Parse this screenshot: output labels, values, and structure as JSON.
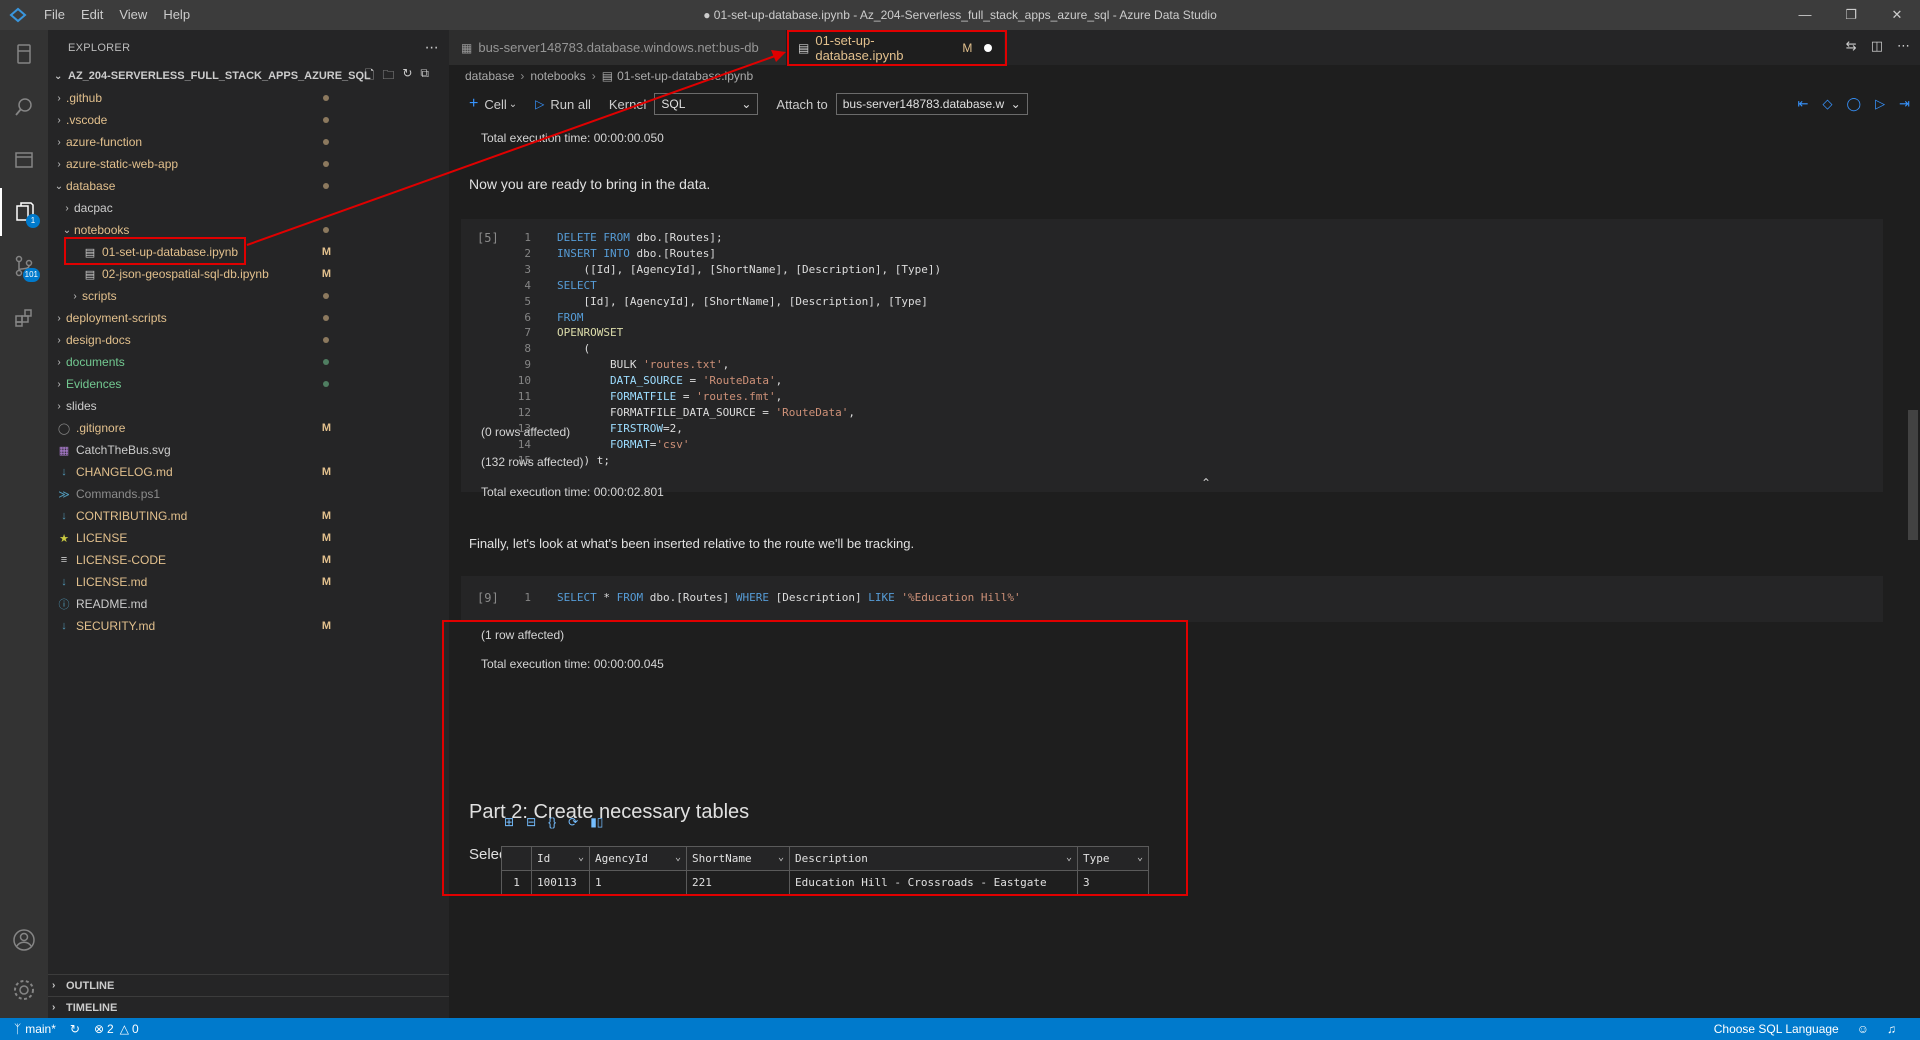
{
  "window": {
    "title": "● 01-set-up-database.ipynb - Az_204-Serverless_full_stack_apps_azure_sql - Azure Data Studio",
    "menu": [
      "File",
      "Edit",
      "View",
      "Help"
    ]
  },
  "activity": {
    "badge_explorer": "1",
    "badge_scm": "101"
  },
  "sidebar": {
    "header": "EXPLORER",
    "root": "AZ_204-SERVERLESS_FULL_STACK_APPS_AZURE_SQL",
    "items": [
      {
        "label": ".github",
        "badge": ""
      },
      {
        "label": ".vscode",
        "badge": ""
      },
      {
        "label": "azure-function",
        "badge": ""
      },
      {
        "label": "azure-static-web-app",
        "badge": ""
      },
      {
        "label": "database",
        "badge": ""
      },
      {
        "label": "dacpac",
        "badge": ""
      },
      {
        "label": "notebooks",
        "badge": ""
      },
      {
        "label": "01-set-up-database.ipynb",
        "badge": "M"
      },
      {
        "label": "02-json-geospatial-sql-db.ipynb",
        "badge": "M"
      },
      {
        "label": "scripts",
        "badge": ""
      },
      {
        "label": "deployment-scripts",
        "badge": ""
      },
      {
        "label": "design-docs",
        "badge": ""
      },
      {
        "label": "documents",
        "badge": ""
      },
      {
        "label": "Evidences",
        "badge": ""
      },
      {
        "label": "slides",
        "badge": ""
      },
      {
        "label": ".gitignore",
        "badge": "M"
      },
      {
        "label": "CatchTheBus.svg",
        "badge": ""
      },
      {
        "label": "CHANGELOG.md",
        "badge": "M"
      },
      {
        "label": "Commands.ps1",
        "badge": ""
      },
      {
        "label": "CONTRIBUTING.md",
        "badge": "M"
      },
      {
        "label": "LICENSE",
        "badge": "M"
      },
      {
        "label": "LICENSE-CODE",
        "badge": "M"
      },
      {
        "label": "LICENSE.md",
        "badge": "M"
      },
      {
        "label": "README.md",
        "badge": ""
      },
      {
        "label": "SECURITY.md",
        "badge": "M"
      }
    ],
    "outline": "OUTLINE",
    "timeline": "TIMELINE"
  },
  "tabs": [
    {
      "label": "bus-server148783.database.windows.net:bus-db"
    },
    {
      "label": "01-set-up-database.ipynb",
      "status": "M"
    }
  ],
  "breadcrumb": [
    "database",
    "notebooks",
    "01-set-up-database.ipynb"
  ],
  "toolbar": {
    "cell": "Cell",
    "run_all": "Run all",
    "kernel_label": "Kernel",
    "kernel_value": "SQL",
    "attach_label": "Attach to",
    "attach_value": "bus-server148783.database.w"
  },
  "notebook": {
    "exec_time_top": "Total execution time: 00:00:00.050",
    "md_ready": "Now you are ready to bring in the data.",
    "cell5": {
      "count": "[5]",
      "lines": [
        [
          {
            "t": "DELETE FROM ",
            "c": "kw"
          },
          {
            "t": "dbo.[Routes];",
            "c": "id"
          }
        ],
        [
          {
            "t": "INSERT INTO ",
            "c": "kw"
          },
          {
            "t": "dbo.[Routes]",
            "c": "id"
          }
        ],
        [
          {
            "t": "    ([Id], [AgencyId], [ShortName], [Description], [Type])",
            "c": "id"
          }
        ],
        [
          {
            "t": "SELECT",
            "c": "kw"
          }
        ],
        [
          {
            "t": "    [Id], [AgencyId], [ShortName], [Description], [Type]",
            "c": "id"
          }
        ],
        [
          {
            "t": "FROM",
            "c": "kw"
          }
        ],
        [
          {
            "t": "OPENROWSET",
            "c": "fn"
          }
        ],
        [
          {
            "t": "    (",
            "c": "id"
          }
        ],
        [
          {
            "t": "        BULK ",
            "c": "id"
          },
          {
            "t": "'routes.txt'",
            "c": "str"
          },
          {
            "t": ",",
            "c": "id"
          }
        ],
        [
          {
            "t": "        DATA_SOURCE",
            "c": "ref"
          },
          {
            "t": " = ",
            "c": "id"
          },
          {
            "t": "'RouteData'",
            "c": "str"
          },
          {
            "t": ",",
            "c": "id"
          }
        ],
        [
          {
            "t": "        FORMATFILE",
            "c": "ref"
          },
          {
            "t": " = ",
            "c": "id"
          },
          {
            "t": "'routes.fmt'",
            "c": "str"
          },
          {
            "t": ",",
            "c": "id"
          }
        ],
        [
          {
            "t": "        FORMATFILE_DATA_SOURCE = ",
            "c": "id"
          },
          {
            "t": "'RouteData'",
            "c": "str"
          },
          {
            "t": ",",
            "c": "id"
          }
        ],
        [
          {
            "t": "        FIRSTROW",
            "c": "ref"
          },
          {
            "t": "=2,",
            "c": "id"
          }
        ],
        [
          {
            "t": "        FORMAT",
            "c": "ref"
          },
          {
            "t": "=",
            "c": "id"
          },
          {
            "t": "'csv'",
            "c": "str"
          }
        ],
        [
          {
            "t": "    ) t;",
            "c": "id"
          }
        ]
      ]
    },
    "out_rows0": "(0 rows affected)",
    "out_rows132": "(132 rows affected)",
    "exec_time_5": "Total execution time: 00:00:02.801",
    "md_finally": "Finally, let's look at what's been inserted relative to the route we'll be tracking.",
    "cell9": {
      "count": "[9]",
      "line": [
        {
          "t": "SELECT ",
          "c": "kw"
        },
        {
          "t": "* ",
          "c": "id"
        },
        {
          "t": "FROM ",
          "c": "kw"
        },
        {
          "t": "dbo.[Routes] ",
          "c": "id"
        },
        {
          "t": "WHERE ",
          "c": "kw"
        },
        {
          "t": "[Description] ",
          "c": "id"
        },
        {
          "t": "LIKE ",
          "c": "kw"
        },
        {
          "t": "'%Education Hill%'",
          "c": "str"
        }
      ]
    },
    "out_row1": "(1 row affected)",
    "exec_time_9": "Total execution time: 00:00:00.045",
    "grid": {
      "columns": [
        "Id",
        "AgencyId",
        "ShortName",
        "Description",
        "Type"
      ],
      "rows": [
        [
          "1",
          "100113",
          "1",
          "221",
          "Education Hill - Crossroads - Eastgate",
          "3"
        ]
      ]
    },
    "heading_part2": "Part 2: Create necessary tables",
    "md_select_route": "Select a route to monitor"
  },
  "statusbar": {
    "branch": "main*",
    "errors": "2",
    "warnings": "0",
    "language": "Choose SQL Language"
  },
  "colors": {
    "accent": "#007acc",
    "annotation_red": "#e00000",
    "modified": "#e2c08d",
    "untracked": "#73c991"
  }
}
